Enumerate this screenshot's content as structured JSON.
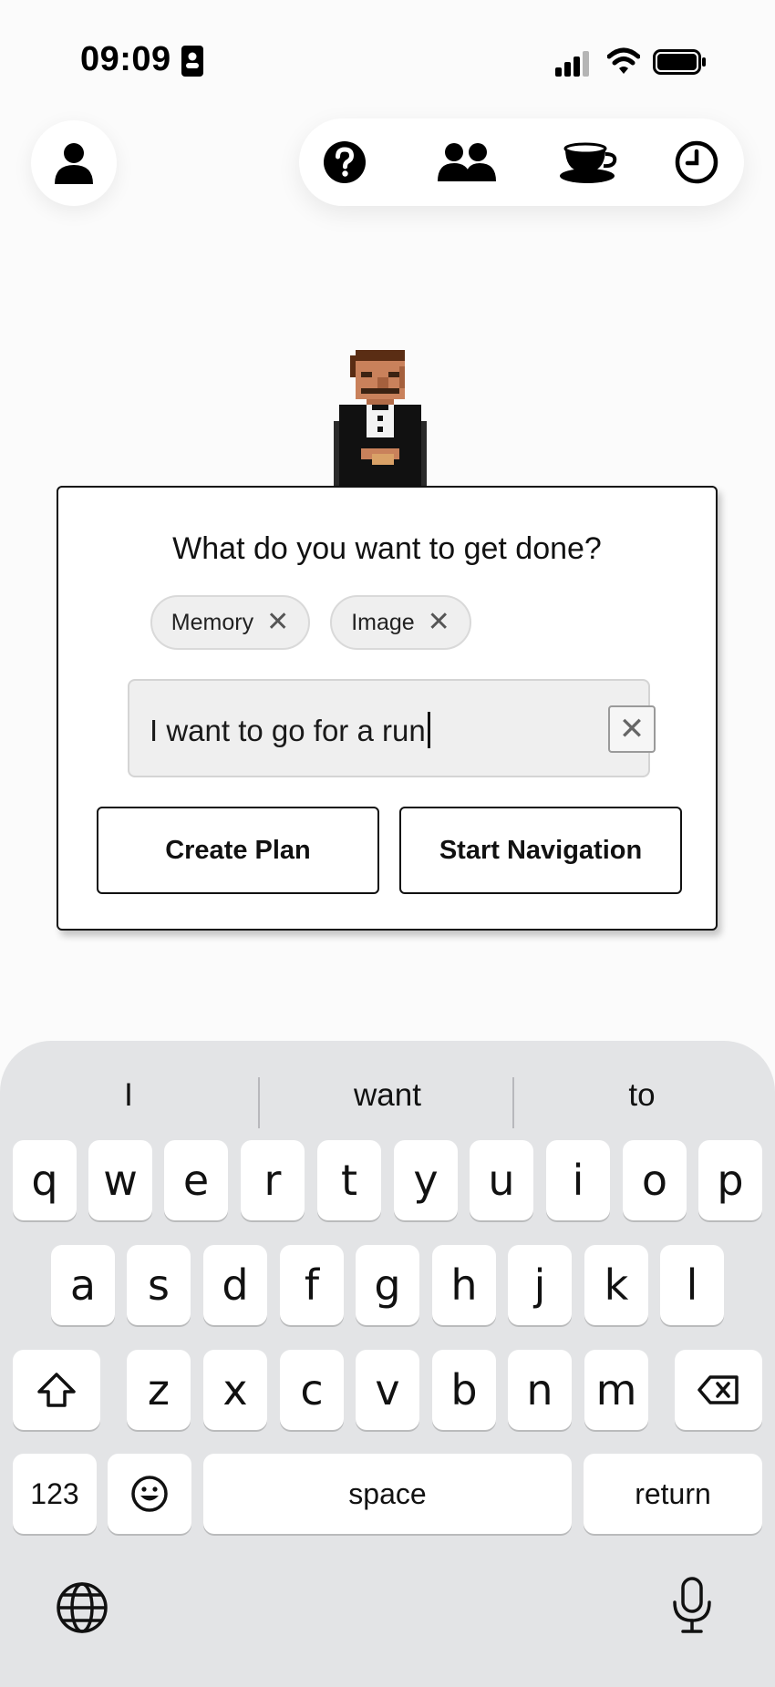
{
  "status_bar": {
    "time": "09:09",
    "icons": [
      "id-card-icon",
      "cellular-signal-icon",
      "wifi-icon",
      "battery-icon"
    ]
  },
  "nav": {
    "profile_icon": "person-icon",
    "buttons": [
      "help-icon",
      "people-icon",
      "coffee-cup-icon",
      "clock-icon"
    ]
  },
  "card": {
    "title": "What do you want to get done?",
    "chips": [
      {
        "label": "Memory",
        "remove": "✕"
      },
      {
        "label": "Image",
        "remove": "✕"
      }
    ],
    "input_value": "I want to go for a run",
    "clear_label": "✕",
    "buttons": {
      "create_plan": "Create Plan",
      "start_navigation": "Start Navigation"
    }
  },
  "keyboard": {
    "suggestions": [
      "I",
      "want",
      "to"
    ],
    "row1": [
      "q",
      "w",
      "e",
      "r",
      "t",
      "y",
      "u",
      "i",
      "o",
      "p"
    ],
    "row2": [
      "a",
      "s",
      "d",
      "f",
      "g",
      "h",
      "j",
      "k",
      "l"
    ],
    "row3": [
      "z",
      "x",
      "c",
      "v",
      "b",
      "n",
      "m"
    ],
    "numbers_label": "123",
    "space_label": "space",
    "return_label": "return",
    "icons": [
      "shift-icon",
      "backspace-icon",
      "emoji-icon",
      "globe-icon",
      "microphone-icon"
    ]
  },
  "colors": {
    "background": "#fbfbfb",
    "keyboard_background": "#e3e4e6",
    "chip_background": "#efefef",
    "border": "#111111"
  }
}
